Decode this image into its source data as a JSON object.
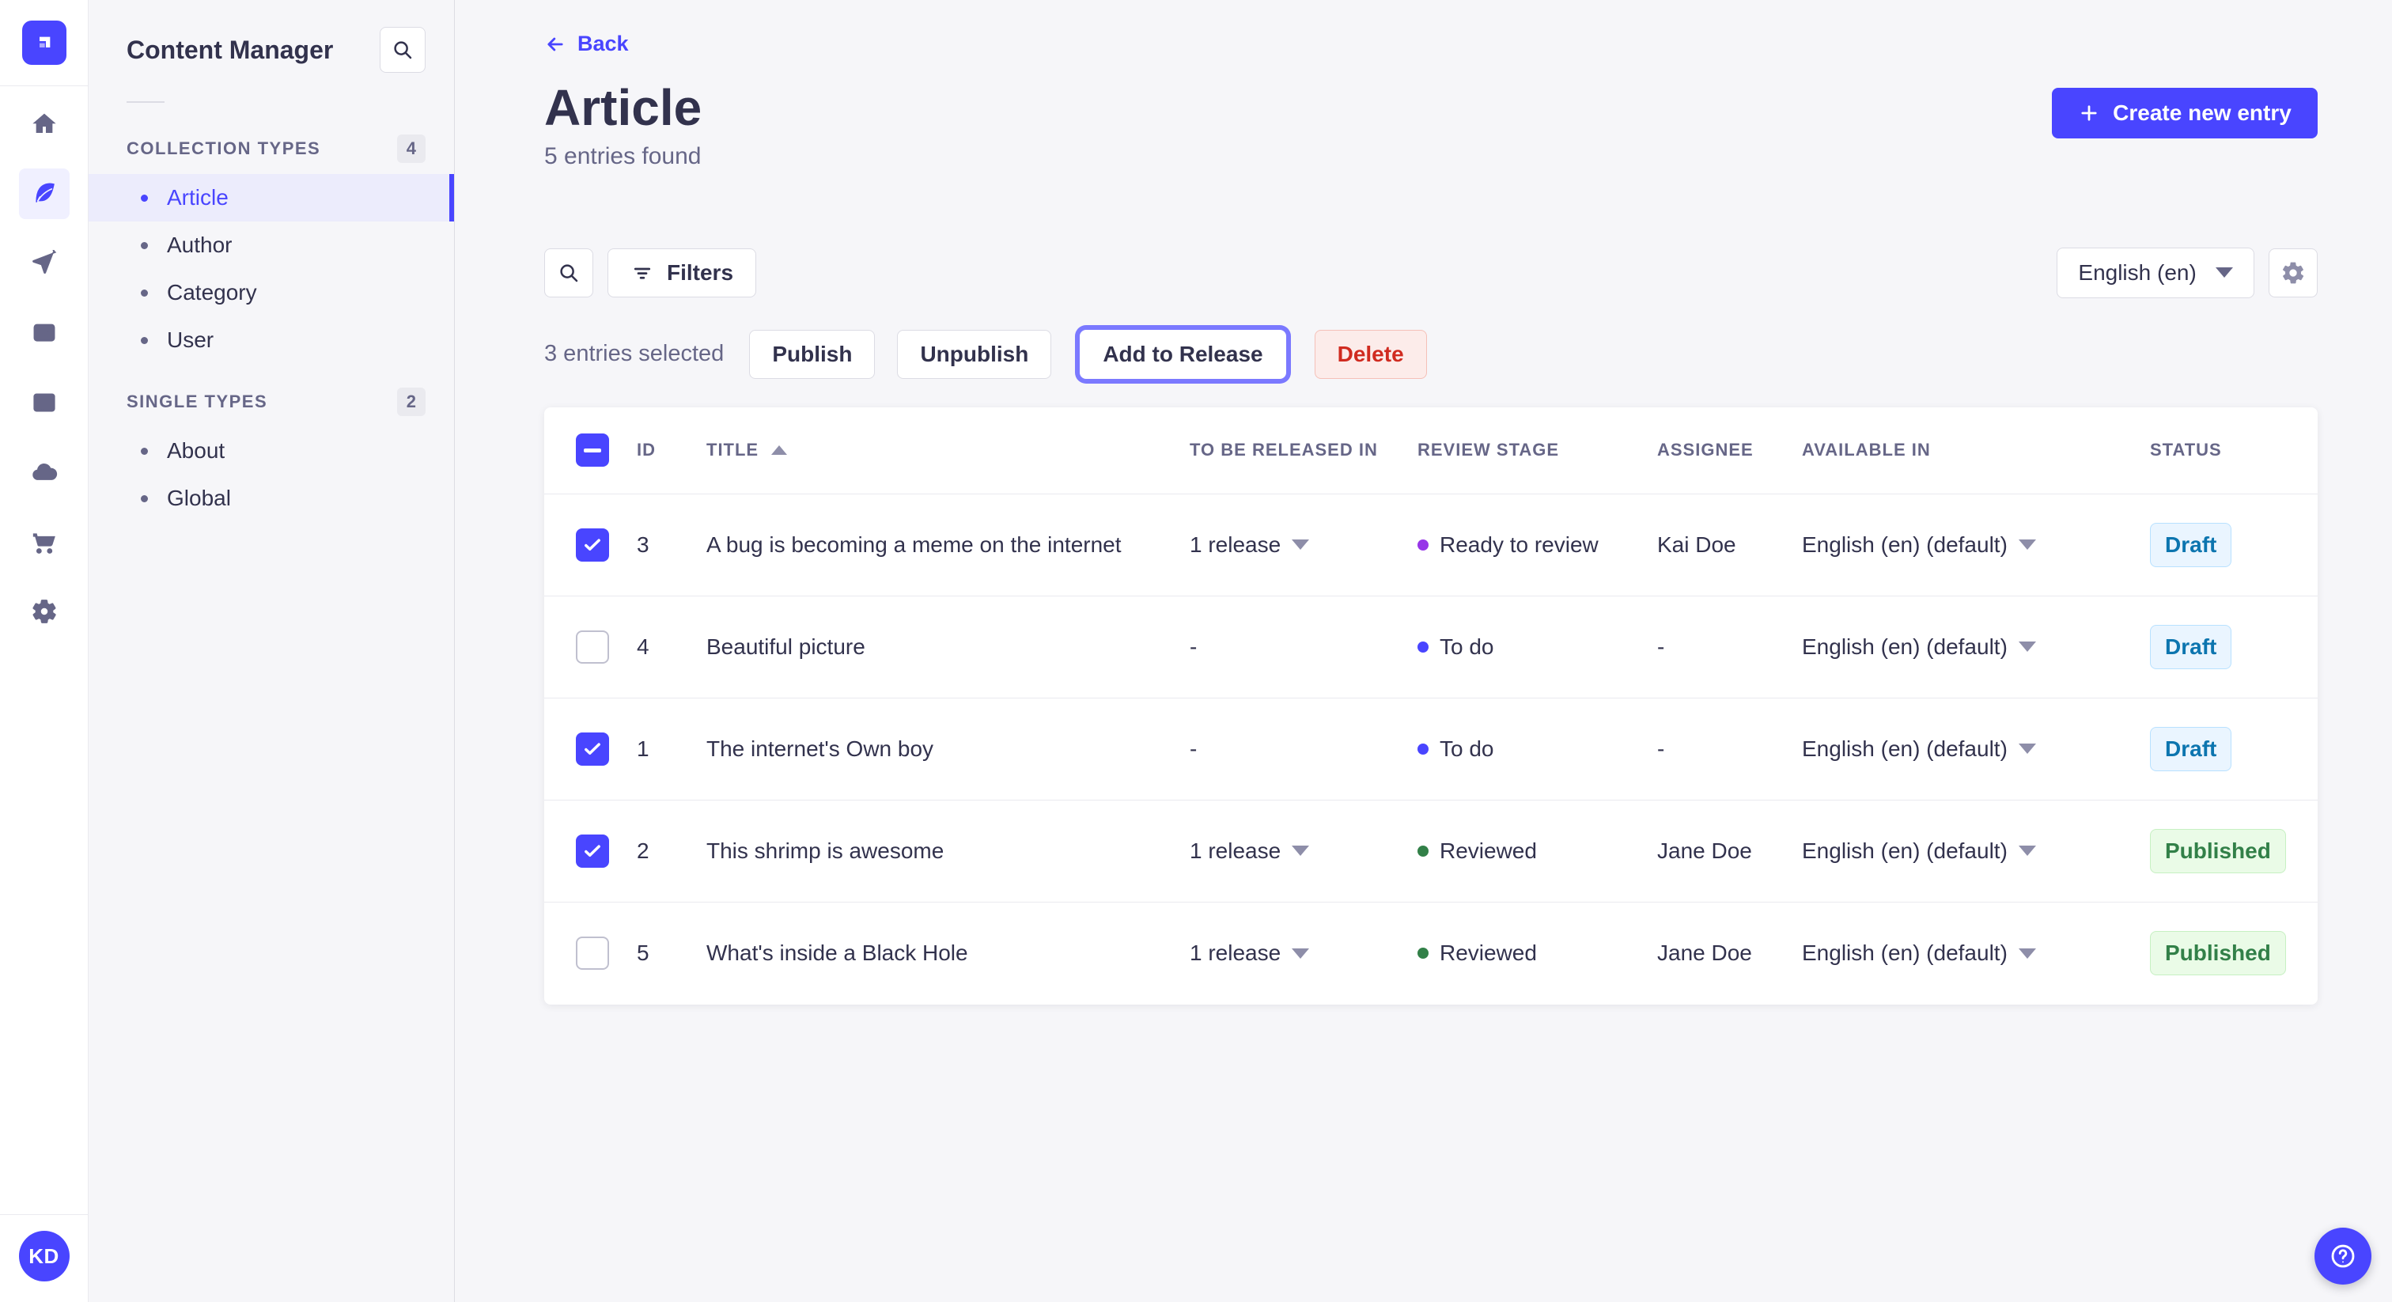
{
  "colors": {
    "primary": "#4945ff",
    "draft_badge": {
      "bg": "#eaf5ff",
      "border": "#b8e1ff",
      "text": "#0c75af"
    },
    "published_badge": {
      "bg": "#eafbe7",
      "border": "#c6f0c2",
      "text": "#328048"
    },
    "delete_button": {
      "bg": "#fcecea",
      "border": "#f5c0b8",
      "text": "#d02b20"
    },
    "stage_ready_to_review": "#9736e8",
    "stage_to_do": "#4945ff",
    "stage_reviewed": "#328048"
  },
  "nav": {
    "icons": [
      "strapi-logo-icon",
      "home-icon",
      "content-manager-feather-icon",
      "releases-paper-plane-icon",
      "media-library-images-icon",
      "content-type-builder-layout-icon",
      "deploy-cloud-icon",
      "marketplace-cart-icon",
      "settings-gear-icon",
      "help-icon"
    ],
    "avatar_initials": "KD"
  },
  "sidebar": {
    "title": "Content Manager",
    "collection_types": {
      "label": "COLLECTION TYPES",
      "count": "4",
      "items": [
        {
          "label": "Article",
          "active": true
        },
        {
          "label": "Author",
          "active": false
        },
        {
          "label": "Category",
          "active": false
        },
        {
          "label": "User",
          "active": false
        }
      ]
    },
    "single_types": {
      "label": "SINGLE TYPES",
      "count": "2",
      "items": [
        {
          "label": "About",
          "active": false
        },
        {
          "label": "Global",
          "active": false
        }
      ]
    }
  },
  "header": {
    "back_label": "Back",
    "title": "Article",
    "subtitle": "5 entries found",
    "create_button_label": "Create new entry"
  },
  "toolbar": {
    "filters_label": "Filters",
    "locale_selected": "English (en)"
  },
  "selection": {
    "text": "3 entries selected",
    "publish_label": "Publish",
    "unpublish_label": "Unpublish",
    "add_to_release_label": "Add to Release",
    "delete_label": "Delete"
  },
  "table": {
    "columns": {
      "id": "ID",
      "title": "TITLE",
      "release": "TO BE RELEASED IN",
      "stage": "REVIEW STAGE",
      "assignee": "ASSIGNEE",
      "available": "AVAILABLE IN",
      "status": "STATUS"
    },
    "sort": {
      "column": "TITLE",
      "direction": "asc"
    },
    "rows": [
      {
        "checked": true,
        "id": "3",
        "title": "A bug is becoming a meme on the internet",
        "release": "1 release",
        "stage": "Ready to review",
        "stage_color": "#9736e8",
        "assignee": "Kai Doe",
        "locale": "English (en) (default)",
        "status": "Draft"
      },
      {
        "checked": false,
        "id": "4",
        "title": "Beautiful picture",
        "release": "-",
        "stage": "To do",
        "stage_color": "#4945ff",
        "assignee": "-",
        "locale": "English (en) (default)",
        "status": "Draft"
      },
      {
        "checked": true,
        "id": "1",
        "title": "The internet's Own boy",
        "release": "-",
        "stage": "To do",
        "stage_color": "#4945ff",
        "assignee": "-",
        "locale": "English (en) (default)",
        "status": "Draft"
      },
      {
        "checked": true,
        "id": "2",
        "title": "This shrimp is awesome",
        "release": "1 release",
        "stage": "Reviewed",
        "stage_color": "#328048",
        "assignee": "Jane Doe",
        "locale": "English (en) (default)",
        "status": "Published"
      },
      {
        "checked": false,
        "id": "5",
        "title": "What's inside a Black Hole",
        "release": "1 release",
        "stage": "Reviewed",
        "stage_color": "#328048",
        "assignee": "Jane Doe",
        "locale": "English (en) (default)",
        "status": "Published"
      }
    ]
  }
}
